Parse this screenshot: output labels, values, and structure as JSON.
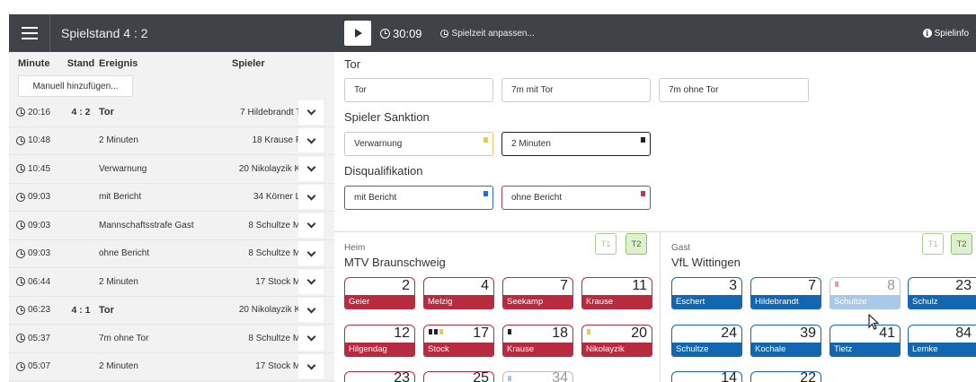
{
  "header": {
    "score_title": "Spielstand 4 : 2",
    "timer": "30:09",
    "adjust_label": "Spielzeit anpassen...",
    "info_label": "Spielinfo"
  },
  "events_table": {
    "headers": {
      "minute": "Minute",
      "stand": "Stand",
      "event": "Ereignis",
      "player": "Spieler"
    },
    "manual_add_label": "Manuell hinzufügen...",
    "rows": [
      {
        "minute": "20:16",
        "stand": "4 : 2",
        "event": "Tor",
        "player": "7 Hildebrandt T."
      },
      {
        "minute": "10:48",
        "stand": "",
        "event": "2 Minuten",
        "player": "18 Krause P."
      },
      {
        "minute": "10:45",
        "stand": "",
        "event": "Verwarnung",
        "player": "20 Nikolayzik K."
      },
      {
        "minute": "09:03",
        "stand": "",
        "event": "mit Bericht",
        "player": "34 Körner L."
      },
      {
        "minute": "09:03",
        "stand": "",
        "event": "Mannschaftsstrafe Gast",
        "player": "8 Schultze M."
      },
      {
        "minute": "09:03",
        "stand": "",
        "event": "ohne Bericht",
        "player": "8 Schultze M."
      },
      {
        "minute": "06:44",
        "stand": "",
        "event": "2 Minuten",
        "player": "17 Stock M."
      },
      {
        "minute": "06:23",
        "stand": "4 : 1",
        "event": "Tor",
        "player": "20 Nikolayzik K."
      },
      {
        "minute": "05:37",
        "stand": "",
        "event": "7m ohne Tor",
        "player": "8 Schultze M."
      },
      {
        "minute": "05:07",
        "stand": "",
        "event": "2 Minuten",
        "player": "17 Stock M."
      }
    ]
  },
  "actions": {
    "tor_title": "Tor",
    "tor_buttons": [
      "Tor",
      "7m mit Tor",
      "7m ohne Tor"
    ],
    "sanktion_title": "Spieler Sanktion",
    "sanktion_buttons": [
      "Verwarnung",
      "2 Minuten"
    ],
    "disq_title": "Disqualifikation",
    "disq_buttons": [
      "mit Bericht",
      "ohne Bericht"
    ]
  },
  "colors": {
    "heim": "#b82a3e",
    "gast": "#1366b0",
    "yellow_card": "#e8c85a",
    "topbar": "#3f4246"
  },
  "heim": {
    "label": "Heim",
    "name": "MTV Braunschweig",
    "t1": "T1",
    "t2": "T2",
    "players": [
      {
        "num": "2",
        "name": "Geier"
      },
      {
        "num": "4",
        "name": "Melzig"
      },
      {
        "num": "7",
        "name": "Seekamp"
      },
      {
        "num": "11",
        "name": "Krause"
      },
      {
        "num": "12",
        "name": "Hilgendag"
      },
      {
        "num": "17",
        "name": "Stock"
      },
      {
        "num": "18",
        "name": "Krause"
      },
      {
        "num": "20",
        "name": "Nikolayzik"
      },
      {
        "num": "23",
        "name": ""
      },
      {
        "num": "25",
        "name": ""
      },
      {
        "num": "34",
        "name": ""
      }
    ]
  },
  "gast": {
    "label": "Gast",
    "name": "VfL Wittingen",
    "t1": "T1",
    "t2": "T2",
    "players": [
      {
        "num": "3",
        "name": "Eschert"
      },
      {
        "num": "7",
        "name": "Hildebrandt"
      },
      {
        "num": "8",
        "name": "Schultze"
      },
      {
        "num": "23",
        "name": "Schulz"
      },
      {
        "num": "24",
        "name": "Schultze"
      },
      {
        "num": "39",
        "name": "Kochale"
      },
      {
        "num": "41",
        "name": "Tietz"
      },
      {
        "num": "84",
        "name": "Lemke"
      },
      {
        "num": "14",
        "name": ""
      },
      {
        "num": "22",
        "name": ""
      }
    ]
  }
}
